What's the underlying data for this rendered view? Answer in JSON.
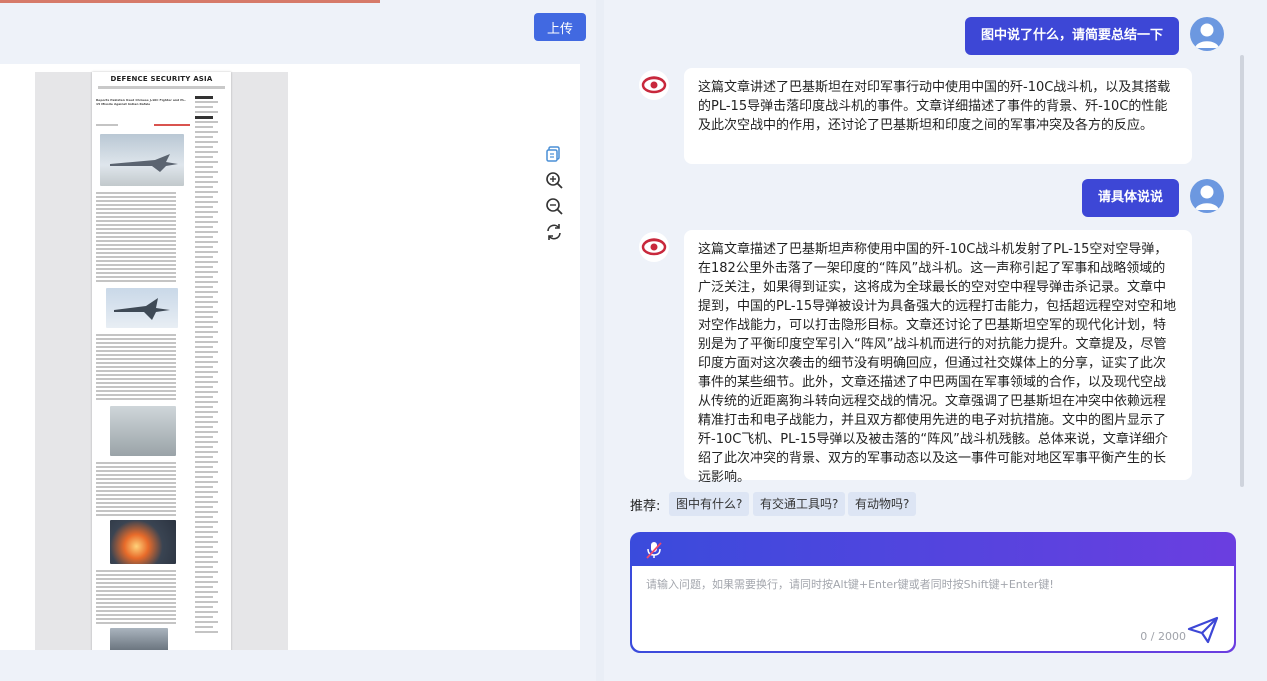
{
  "left": {
    "upload_label": "上传",
    "doc": {
      "masthead": "DEFENCE SECURITY ASIA",
      "headline": "Reports Pakistan Used Chinese J-10C Fighter and PL-15 Missile Against Indian Rafale"
    },
    "tools": [
      "copy-icon",
      "zoom-in-icon",
      "zoom-out-icon",
      "refresh-icon"
    ]
  },
  "chat": {
    "messages": [
      {
        "role": "user",
        "text": "图中说了什么，请简要总结一下"
      },
      {
        "role": "assistant",
        "text": "这篇文章讲述了巴基斯坦在对印军事行动中使用中国的歼-10C战斗机，以及其搭载的PL-15导弹击落印度战斗机的事件。文章详细描述了事件的背景、歼-10C的性能及此次空战中的作用，还讨论了巴基斯坦和印度之间的军事冲突及各方的反应。"
      },
      {
        "role": "user",
        "text": "请具体说说"
      },
      {
        "role": "assistant",
        "text": "这篇文章描述了巴基斯坦声称使用中国的歼-10C战斗机发射了PL-15空对空导弹，在182公里外击落了一架印度的“阵风”战斗机。这一声称引起了军事和战略领域的广泛关注，如果得到证实，这将成为全球最长的空对空中程导弹击杀记录。文章中提到，中国的PL-15导弹被设计为具备强大的远程打击能力，包括超远程空对空和地对空作战能力，可以打击隐形目标。文章还讨论了巴基斯坦空军的现代化计划，特别是为了平衡印度空军引入“阵风”战斗机而进行的对抗能力提升。文章提及，尽管印度方面对这次袭击的细节没有明确回应，但通过社交媒体上的分享，证实了此次事件的某些细节。此外，文章还描述了中巴两国在军事领域的合作，以及现代空战从传统的近距离狗斗转向远程交战的情况。文章强调了巴基斯坦在冲突中依赖远程精准打击和电子战能力，并且双方都使用先进的电子对抗措施。文中的图片显示了歼-10C飞机、PL-15导弹以及被击落的“阵风”战斗机残骸。总体来说，文章详细介绍了此次冲突的背景、双方的军事动态以及这一事件可能对地区军事平衡产生的长远影响。"
      }
    ],
    "recommend_label": "推荐:",
    "suggestions": [
      "图中有什么?",
      "有交通工具吗?",
      "有动物吗?"
    ],
    "input": {
      "placeholder": "请输入问题，如果需要换行，请同时按Alt键+Enter键或者同时按Shift键+Enter键!",
      "value": "",
      "counter": "0 / 2000"
    }
  },
  "colors": {
    "accent": "#3d47d6",
    "gradient_end": "#6b3ee0",
    "upload": "#4169e1",
    "brand_red": "#c8283c"
  }
}
